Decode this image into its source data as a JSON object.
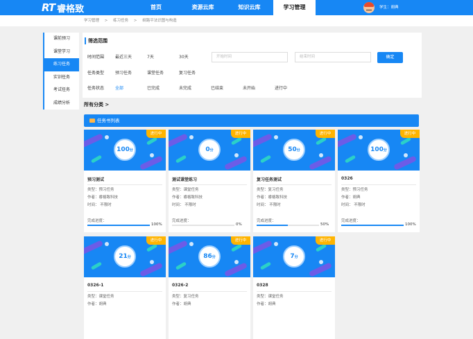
{
  "header": {
    "logo_rt": "RT",
    "logo_text": "睿格致",
    "nav": [
      "首页",
      "资源云库",
      "知识云库",
      "学习管理"
    ],
    "user_label": "学生：胡典"
  },
  "breadcrumb": [
    "学习管理",
    ">",
    "练习任务",
    ">",
    "纲路平法识图与构造"
  ],
  "sidebar": [
    "课前预习",
    "课堂学习",
    "练习任务",
    "实训任务",
    "考试任务",
    "成绩分析"
  ],
  "filter": {
    "title": "筛选范围",
    "time_label": "时间范围",
    "time_options": [
      "最近三天",
      "7天",
      "30天"
    ],
    "start_placeholder": "开始时间",
    "end_placeholder": "结束时间",
    "confirm": "确定",
    "type_label": "任务类型",
    "type_options": [
      "预习任务",
      "课堂任务",
      "复习任务"
    ],
    "status_label": "任务状态",
    "status_options": [
      "全部",
      "已完成",
      "未完成",
      "已结束",
      "未开始",
      "进行中"
    ]
  },
  "all_categories": "所有分类 >",
  "list_title": "任务书列表",
  "labels": {
    "progress": "完成进度：",
    "unit": "分"
  },
  "cards": [
    {
      "status": "进行中",
      "score": "100",
      "title": "预习测试",
      "type": "类型：预习任务",
      "author": "作者：睿格致科技",
      "time": "时间： 不限时",
      "progress": "100%",
      "pct": 100
    },
    {
      "status": "进行中",
      "score": "0",
      "title": "测试课堂练习",
      "type": "类型：课堂任务",
      "author": "作者：睿格致科技",
      "time": "时间： 不限时",
      "progress": "0%",
      "pct": 0
    },
    {
      "status": "进行中",
      "score": "50",
      "title": "复习任务测试",
      "type": "类型：复习任务",
      "author": "作者：睿格致科技",
      "time": "时间： 不限时",
      "progress": "50%",
      "pct": 50
    },
    {
      "status": "进行中",
      "score": "100",
      "title": "0326",
      "type": "类型：预习任务",
      "author": "作者：胡典",
      "time": "时间： 不限时",
      "progress": "100%",
      "pct": 100
    },
    {
      "status": "进行中",
      "score": "21",
      "title": "0326-1",
      "type": "类型：课堂任务",
      "author": "作者：胡典",
      "time": "",
      "progress": "",
      "pct": null
    },
    {
      "status": "进行中",
      "score": "86",
      "title": "0326-2",
      "type": "类型：复习任务",
      "author": "作者：胡典",
      "time": "",
      "progress": "",
      "pct": null
    },
    {
      "status": "进行中",
      "score": "7",
      "title": "0328",
      "type": "类型：课堂任务",
      "author": "作者：胡典",
      "time": "",
      "progress": "",
      "pct": null
    }
  ],
  "colors": {
    "primary": "#1787f4",
    "tag": "#ffb400"
  }
}
